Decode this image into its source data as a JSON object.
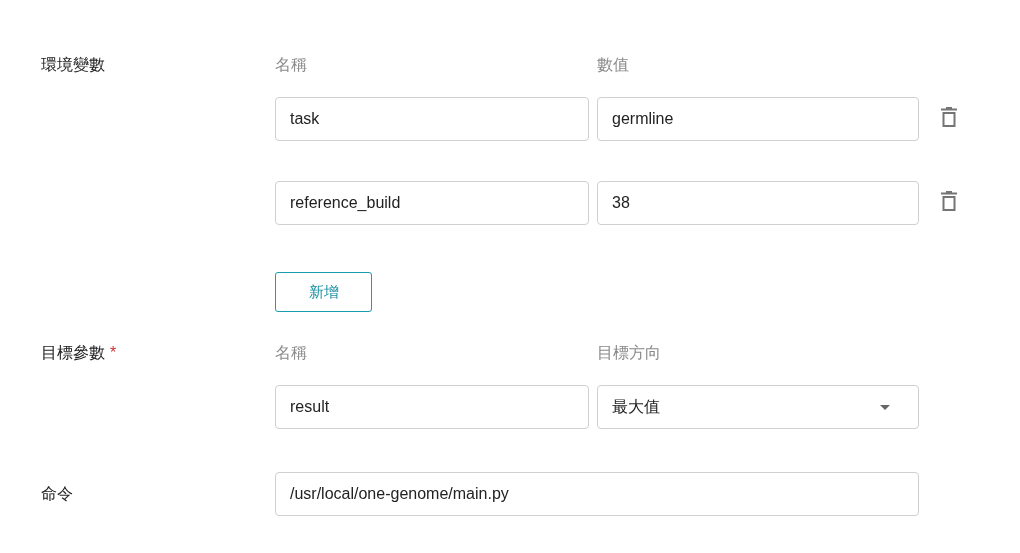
{
  "environment": {
    "label": "環境變數",
    "headers": [
      "名稱",
      "數值"
    ],
    "rows": [
      {
        "name": "task",
        "value": "germline"
      },
      {
        "name": "reference_build",
        "value": "38"
      }
    ],
    "add_button": "新增"
  },
  "objective": {
    "label": "目標參數",
    "required_mark": "*",
    "headers": [
      "名稱",
      "目標方向"
    ],
    "name": "result",
    "direction": "最大值"
  },
  "command": {
    "label": "命令",
    "value": "/usr/local/one-genome/main.py"
  }
}
